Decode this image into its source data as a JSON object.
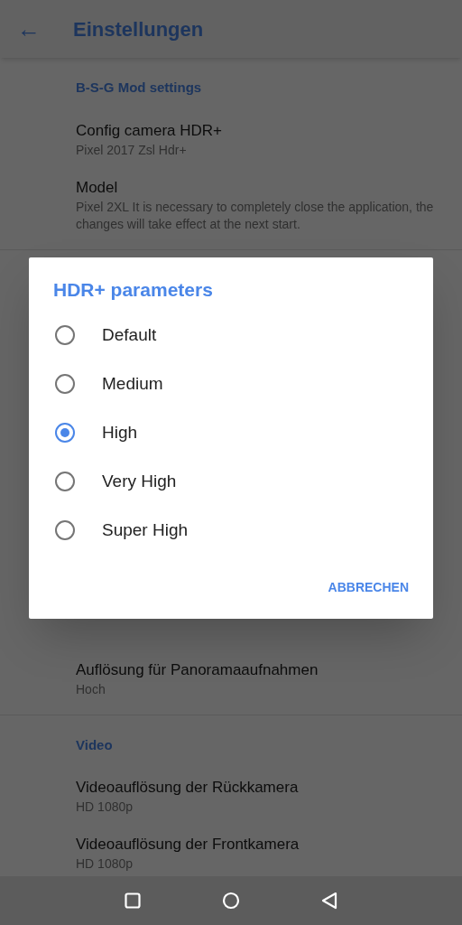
{
  "app_bar": {
    "back": "←",
    "title": "Einstellungen"
  },
  "sections_top": [
    {
      "header": "B-S-G Mod settings",
      "items": [
        {
          "title": "Config camera HDR+",
          "summary": "Pixel 2017 Zsl Hdr+"
        },
        {
          "title": "Model",
          "summary": "Pixel 2XL It is necessary to completely close the application, the changes will take effect at the next start."
        }
      ]
    }
  ],
  "sections_bottom": [
    {
      "items": [
        {
          "title": "Auflösung für Panoramaaufnahmen",
          "summary": "Hoch"
        }
      ]
    },
    {
      "header": "Video",
      "items": [
        {
          "title": "Videoauflösung der Rückkamera",
          "summary": "HD 1080p"
        },
        {
          "title": "Videoauflösung der Frontkamera",
          "summary": "HD 1080p"
        }
      ]
    }
  ],
  "dialog": {
    "title": "HDR+ parameters",
    "options": [
      {
        "label": "Default",
        "selected": false
      },
      {
        "label": "Medium",
        "selected": false
      },
      {
        "label": "High",
        "selected": true
      },
      {
        "label": "Very High",
        "selected": false
      },
      {
        "label": "Super High",
        "selected": false
      }
    ],
    "button": "ABBRECHEN"
  }
}
